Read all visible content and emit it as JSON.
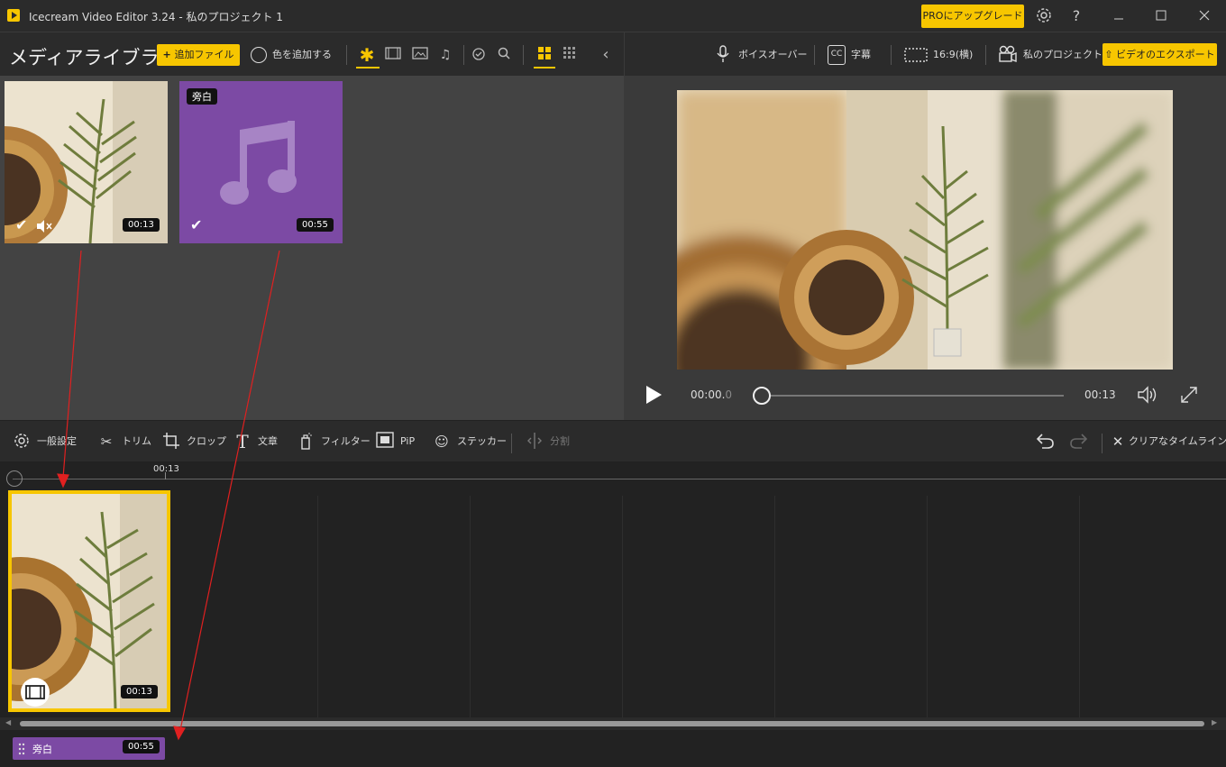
{
  "window": {
    "title": "Icecream Video Editor 3.24  -  私のプロジェクト 1",
    "upgrade_label": "PROにアップグレード",
    "controls": [
      "settings-icon",
      "help-icon",
      "minimize-icon",
      "maximize-icon",
      "close-icon"
    ],
    "help_glyph": "?"
  },
  "library": {
    "title": "メディアライブラリ",
    "add_file_label": "追加ファイル",
    "add_color_label": "色を追加する",
    "filter_icons": [
      "star-icon",
      "film-icon",
      "image-icon",
      "music-icon"
    ],
    "items": [
      {
        "type": "video",
        "duration": "00:13",
        "selected": true,
        "muted": true
      },
      {
        "type": "audio",
        "tag": "旁白",
        "duration": "00:55",
        "selected": true
      }
    ]
  },
  "preview": {
    "voiceover_label": "ボイスオーバー",
    "subtitles_label": "字幕",
    "aspect_label": "16:9(横)",
    "project_label": "私のプロジェクト",
    "export_label": "ビデオのエクスポート",
    "current_time_main": "00:00.",
    "current_time_frac": "0",
    "total_time": "00:13",
    "progress": 0
  },
  "tools": {
    "general_settings": "一般設定",
    "trim": "トリム",
    "crop": "クロップ",
    "text": "文章",
    "filter": "フィルター",
    "pip": "PiP",
    "sticker": "ステッカー",
    "split": "分割",
    "clear_timeline": "クリアなタイムライン"
  },
  "timeline": {
    "ruler_label": "00:13",
    "video_clip_duration": "00:13",
    "audio_clip_name": "旁白",
    "audio_clip_duration": "00:55"
  },
  "colors": {
    "accent": "#f7c600",
    "audio": "#7c4aa4",
    "annotation_arrow": "#e02020"
  }
}
